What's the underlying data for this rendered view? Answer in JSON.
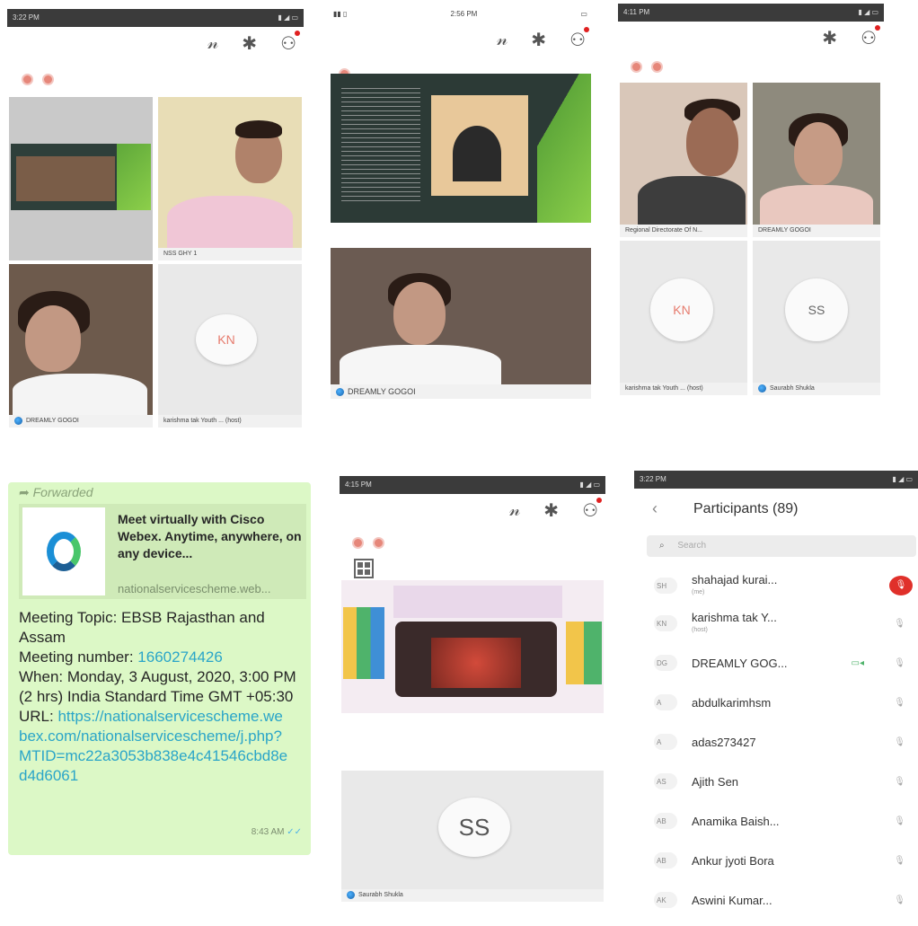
{
  "screen1": {
    "status": "3:22 PM",
    "tile_labels": [
      "NSS GHY 1",
      "DREAMLY GOGOI",
      "karishma tak Youth ... (host)"
    ],
    "avatar_initials": "KN"
  },
  "screen2": {
    "status_time": "2:56 PM",
    "tile_labels": [
      "DREAMLY GOGOI"
    ]
  },
  "screen3": {
    "status": "4:11 PM",
    "tile_labels": [
      "Regional Directorate Of N...",
      "DREAMLY GOGOI",
      "karishma tak Youth ... (host)",
      "Saurabh Shukla"
    ],
    "avatars": [
      "KN",
      "SS"
    ]
  },
  "chat": {
    "forwarded": "Forwarded",
    "preview_title": "Meet virtually with Cisco Webex. Anytime, anywhere, on any device...",
    "preview_site": "nationalservicescheme.web...",
    "lines": [
      {
        "text": "Meeting Topic: EBSB Rajasthan and Assam"
      },
      {
        "prefix": "Meeting number: ",
        "link": "1660274426"
      },
      {
        "text": "When: Monday, 3 August, 2020, 3:00 PM (2 hrs) India Standard Time GMT +05:30"
      },
      {
        "prefix": "URL: ",
        "link": "https://nationalservicescheme.webex.com/nationalservicescheme/j.php?MTID=mc22a3053b838e4c41546cbd8ed4d6061"
      }
    ],
    "time": "8:43 AM"
  },
  "screen5": {
    "status": "4:15 PM",
    "avatar_initials": "SS",
    "tile_label": "Saurabh Shukla"
  },
  "participants": {
    "status": "3:22 PM",
    "title": "Participants (89)",
    "search_placeholder": "Search",
    "items": [
      {
        "initials": "SH",
        "name": "shahajad kurai...",
        "sub": "(me)"
      },
      {
        "initials": "KN",
        "name": "karishma tak Y...",
        "sub": "(host)"
      },
      {
        "initials": "DG",
        "name": "DREAMLY GOG...",
        "sub": ""
      },
      {
        "initials": "A",
        "name": "abdulkarimhsm",
        "sub": ""
      },
      {
        "initials": "A",
        "name": "adas273427",
        "sub": ""
      },
      {
        "initials": "AS",
        "name": "Ajith Sen",
        "sub": ""
      },
      {
        "initials": "AB",
        "name": "Anamika Baish...",
        "sub": ""
      },
      {
        "initials": "AB",
        "name": "Ankur jyoti Bora",
        "sub": ""
      },
      {
        "initials": "AK",
        "name": "Aswini Kumar...",
        "sub": ""
      }
    ]
  },
  "colors": {
    "webex_blue": "#1b8fd6",
    "link": "#2aa5c8",
    "chat_bubble": "#dcf8c6",
    "alert_red": "#e02020"
  }
}
